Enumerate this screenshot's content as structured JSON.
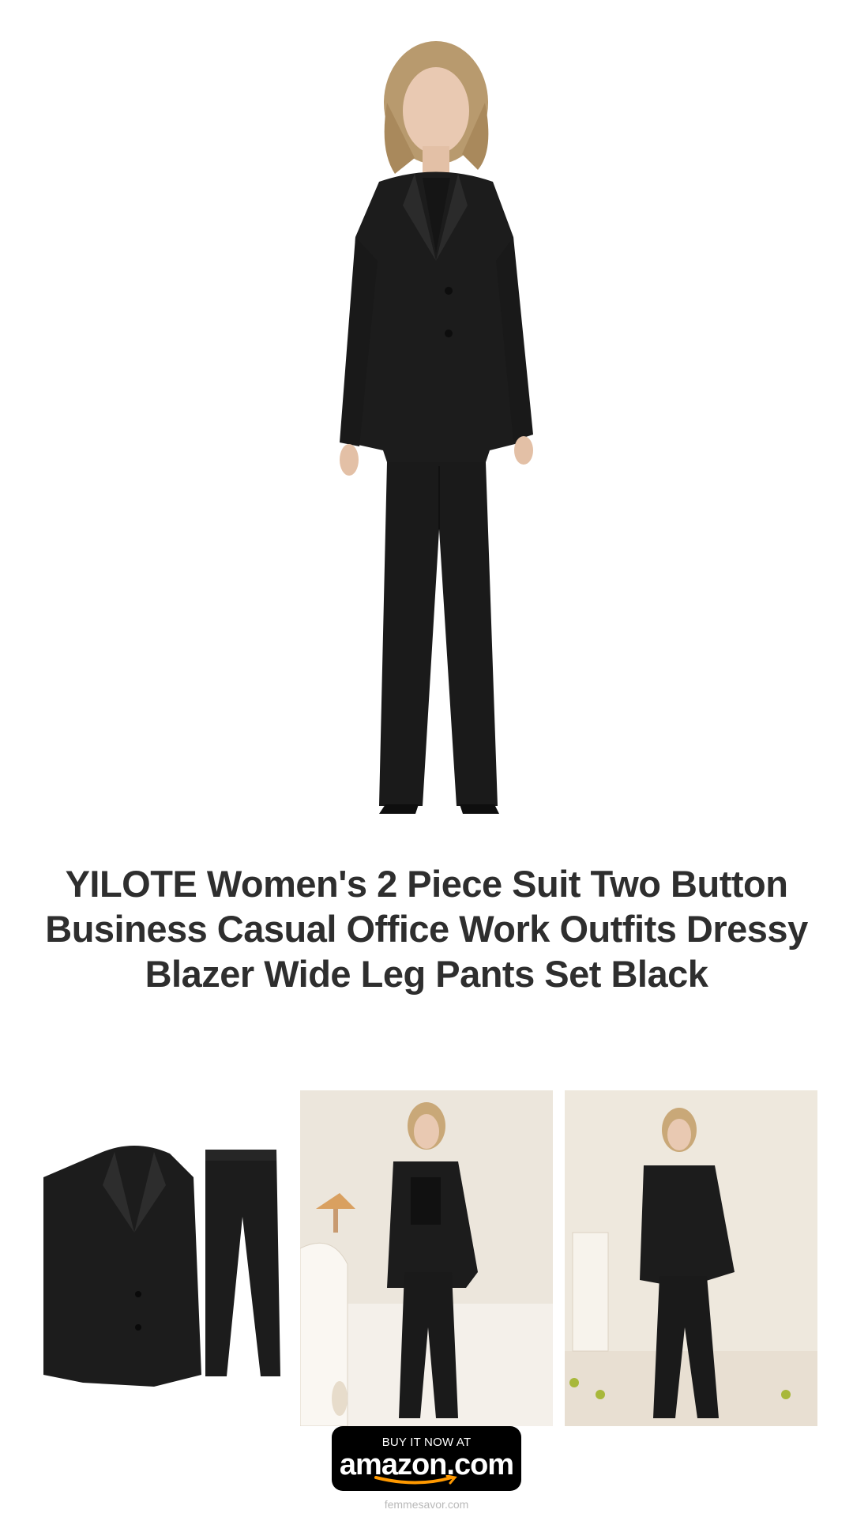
{
  "product": {
    "title": "YILOTE Women's 2 Piece Suit Two Button Business Casual Office Work Outfits Dressy Blazer Wide Leg Pants Set Black"
  },
  "images": {
    "hero": "model-front-view",
    "thumbnails": [
      "suit-flat-lay",
      "model-in-room",
      "model-walking"
    ]
  },
  "cta": {
    "top_label": "BUY IT NOW AT",
    "brand_label": "amazon.com",
    "accent_color": "#FF9900"
  },
  "footer": {
    "site": "femmesavor.com"
  },
  "colors": {
    "suit": "#1c1c1c",
    "title_text": "#2e2e2e"
  }
}
